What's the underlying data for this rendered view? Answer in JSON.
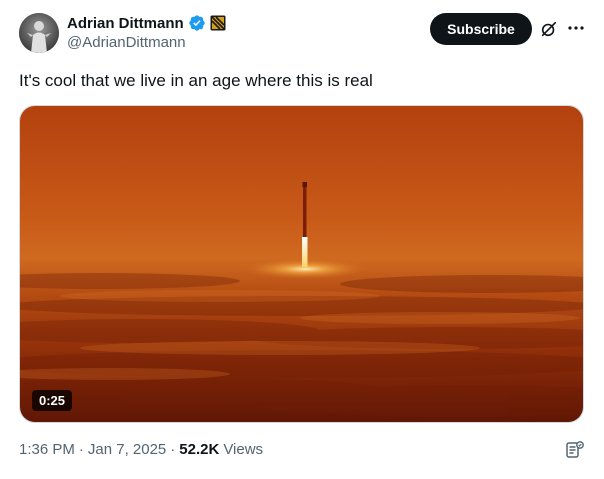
{
  "author": {
    "display_name": "Adrian Dittmann",
    "handle": "@AdrianDittmann",
    "verified_badge_color": "#1d9bf0",
    "affiliate_badge_colors": [
      "#d4a017",
      "#1a1a1a"
    ]
  },
  "header": {
    "subscribe_label": "Subscribe",
    "grok_icon": "grok-slash-icon",
    "more_icon": "more-horizontal-icon"
  },
  "tweet": {
    "text": "It's cool that we live in an age where this is real"
  },
  "media": {
    "type": "video",
    "duration": "0:25",
    "scene": "rocket-above-orange-clouds"
  },
  "meta": {
    "time": "1:36 PM",
    "separator": "·",
    "date": "Jan 7, 2025",
    "views_count": "52.2K",
    "views_label": "Views"
  },
  "colors": {
    "text_primary": "#0f1419",
    "text_secondary": "#536471",
    "button_bg": "#0f1419",
    "link_blue": "#1d9bf0"
  }
}
